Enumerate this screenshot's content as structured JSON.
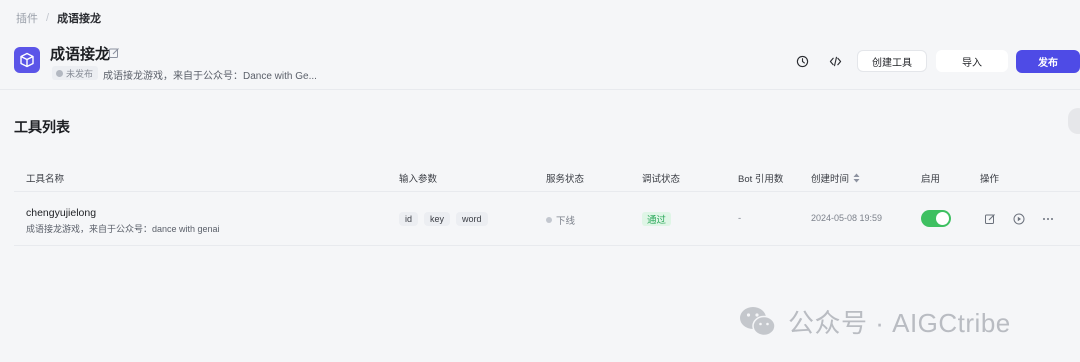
{
  "breadcrumb": {
    "parent": "插件",
    "separator": "/",
    "current": "成语接龙"
  },
  "plugin": {
    "title": "成语接龙",
    "status": "未发布",
    "description": "成语接龙游戏，来自于公众号：Dance with Ge...",
    "icon_color": "#5b55e8"
  },
  "header_actions": {
    "history_icon": "history-icon",
    "code_icon": "code-icon",
    "create_tool": "创建工具",
    "import": "导入",
    "publish": "发布",
    "publish_color": "#4e4be6"
  },
  "section": {
    "title": "工具列表"
  },
  "table": {
    "columns": [
      "工具名称",
      "输入参数",
      "服务状态",
      "调试状态",
      "Bot 引用数",
      "创建时间",
      "启用",
      "操作"
    ],
    "rows": [
      {
        "name": "chengyujielong",
        "description": "成语接龙游戏，来自于公众号：dance with genai",
        "params": [
          "id",
          "key",
          "word"
        ],
        "service_status": "下线",
        "debug_status": "通过",
        "bot_count": "-",
        "created_time": "2024-05-08 19:59",
        "enabled": true,
        "actions": [
          "edit-icon",
          "run-icon",
          "more-icon"
        ]
      }
    ]
  },
  "watermark": {
    "text": "公众号 · AIGCtribe"
  },
  "colors": {
    "enabled_toggle": "#3ec061",
    "debug_pass_text": "#2ba85a",
    "debug_pass_bg": "#dff5e6"
  }
}
